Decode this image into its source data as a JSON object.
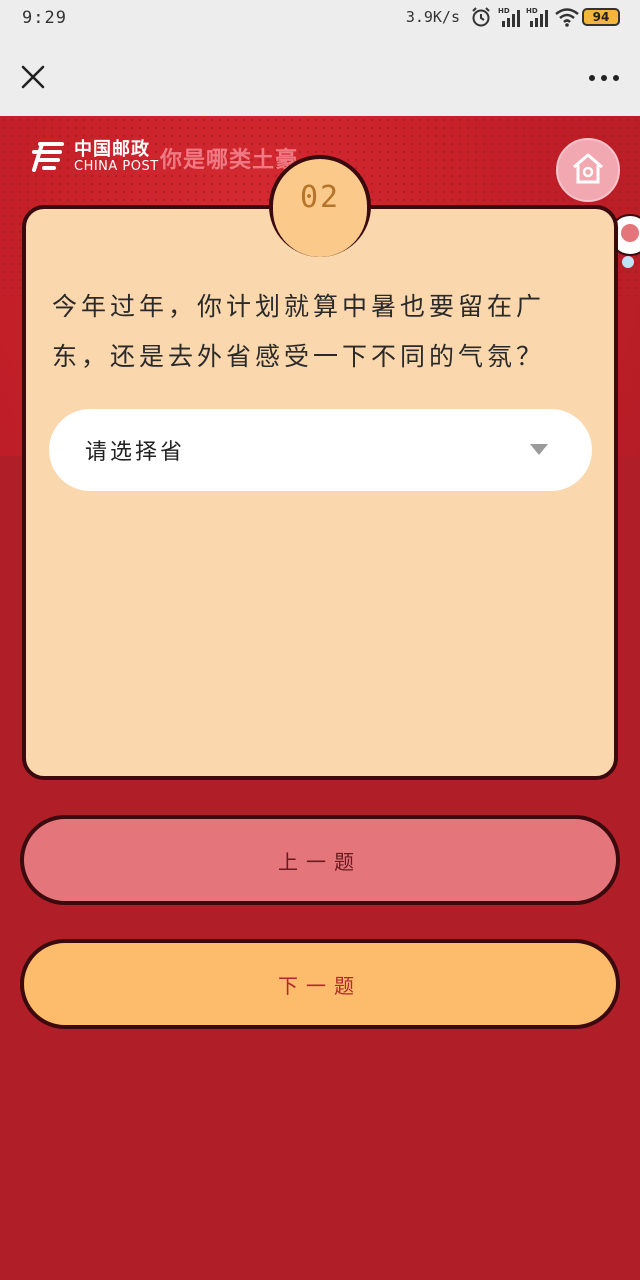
{
  "status_bar": {
    "time": "9:29",
    "net_speed": "3.9K/s",
    "battery": "94"
  },
  "nav": {
    "close_icon": "close-icon",
    "more_icon": "more-icon"
  },
  "header": {
    "logo_cn": "中国邮政",
    "logo_en": "CHINA POST",
    "slogan": "你是哪类土豪"
  },
  "quiz": {
    "number": "02",
    "question": "今年过年，你计划就算中暑也要留在广东，还是去外省感受一下不同的气氛？",
    "select_value": "请选择省"
  },
  "buttons": {
    "prev_label": "上一题",
    "next_label": "下一题"
  },
  "colors": {
    "background": "#b01f28",
    "card": "#fad7ad",
    "prev_button": "#e4767b",
    "next_button": "#fdbb6c"
  }
}
